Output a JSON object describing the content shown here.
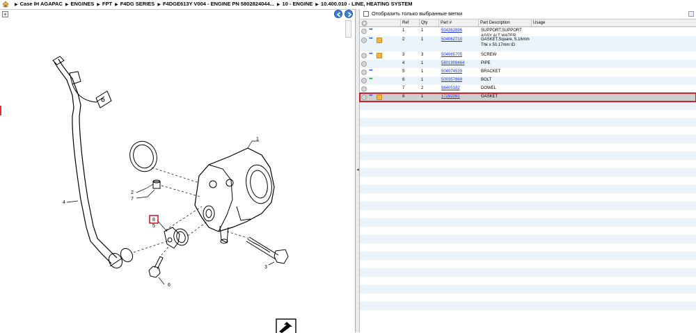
{
  "breadcrumb": {
    "items": [
      "Case IH AGAPAC",
      "ENGINES",
      "FPT",
      "F4DG SERIES",
      "F4DGE613Y V004 - ENGINE PN 5802824044...",
      "10 - ENGINE",
      "10.400.010 - LINE, HEATING SYSTEM"
    ]
  },
  "diagram": {
    "zoom_label": "+",
    "callouts": [
      "1",
      "2",
      "7",
      "8",
      "5",
      "4",
      "3",
      "6"
    ],
    "highlight_color": "#d0202c"
  },
  "filter": {
    "label": "Отобразить только выбранные метки",
    "checked": false
  },
  "table": {
    "headers": [
      "Ref",
      "Qty",
      "Part #",
      "Part Description",
      "Usage"
    ],
    "rows": [
      {
        "ref": "1",
        "qty": "1",
        "part": "504362896",
        "desc": "SUPPORT,SUPPORT ASSY ALT WATER",
        "icons": [
          "circle",
          "arrow-blue"
        ]
      },
      {
        "ref": "2",
        "qty": "1",
        "part": "504062710",
        "desc": "GASKET,Square, 5.16mm Thk x 50.17mm ID",
        "icons": [
          "circle",
          "arrow-blue",
          "box"
        ]
      },
      {
        "ref": "3",
        "qty": "3",
        "part": "504085705",
        "desc": "SCREW",
        "icons": [
          "circle",
          "arrow-blue",
          "box"
        ]
      },
      {
        "ref": "4",
        "qty": "1",
        "part": "5801908464",
        "desc": "PIPE",
        "icons": [
          "circle"
        ]
      },
      {
        "ref": "5",
        "qty": "1",
        "part": "504074539",
        "desc": "BRACKET",
        "icons": [
          "circle",
          "arrow-blue"
        ]
      },
      {
        "ref": "6",
        "qty": "1",
        "part": "500357869",
        "desc": "BOLT",
        "icons": [
          "circle",
          "arrow-green"
        ]
      },
      {
        "ref": "7",
        "qty": "2",
        "part": "98405182",
        "desc": "DOWEL",
        "icons": [
          "circle"
        ]
      },
      {
        "ref": "8",
        "qty": "1",
        "part": "17282081",
        "desc": "GASKET",
        "icons": [
          "circle",
          "arrow-blue",
          "box"
        ],
        "selected": true
      }
    ]
  },
  "colors": {
    "link": "#1a32e6",
    "row_alt": "#ebf3fb",
    "selected_outline": "#d0202c"
  }
}
